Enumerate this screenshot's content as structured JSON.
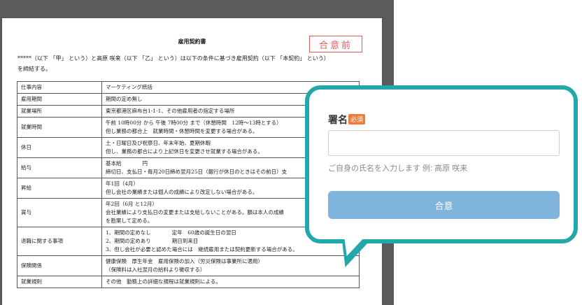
{
  "document": {
    "title": "雇用契約書",
    "stamp": "合意前",
    "intro_line1": "*****（以下 「甲」 という）と高原 咲来（以下 「乙」 という）は以下の条件に基づき雇用契約（以下 「本契約」 という）",
    "intro_line2": "を締結する。",
    "rows": [
      {
        "label": "仕事内容",
        "lines": [
          "マーケティング統括"
        ]
      },
      {
        "label": "雇用期間",
        "lines": [
          "期間の定め無し"
        ]
      },
      {
        "label": "就業場所",
        "lines": [
          "東京都港区麻布台1-1-1、その他雇用者の指定する場所"
        ]
      },
      {
        "label": "就業時間",
        "lines": [
          "午前 10時00分 から 午後 7時00分 まで（休憩時間　12時〜13時とする）",
          "但し業務の都合上　就業時間・休憩時間を変更する場合がある。"
        ]
      },
      {
        "label": "休日",
        "lines": [
          "土・日曜日及び祝祭日、年末年始、夏期休暇",
          "但し、業務の都合により上記休日を変更させ就業する場合がある。"
        ]
      },
      {
        "label": "給与",
        "lines": [
          "基本給　　　　円",
          "締切日、支払日・毎月20日締め翌月25日（銀行が休日のときはその前日）支"
        ]
      },
      {
        "label": "昇給",
        "lines": [
          "年1回（4月）",
          "但し会社の業績または個人の成績により改定しない場合がある。"
        ]
      },
      {
        "label": "賞与",
        "lines": [
          "年2回（6月 と12月）",
          "会社業績により支払日の変更または支給しないことがある。額は本人の成績",
          "を勘案して定める。"
        ]
      },
      {
        "label": "退職に関する事項",
        "lines": [
          "1、期間の定めなし　　　　定年　60歳の誕生日の翌日",
          "2、期間の定めあり　　　　期日到来日",
          "3、但し会社が必要と認めた場合には　継続雇用または契約更新する場合がある。"
        ]
      },
      {
        "label": "保険関係",
        "lines": [
          "健康保険　厚生年金　雇用保険の加入（労災保険は事業所に適用）",
          "（保険料は入社翌月の給料より徴収する）"
        ]
      },
      {
        "label": "就業規則",
        "lines": [
          "その他　勤務上の詳細な規程は就業規則による。"
        ]
      }
    ]
  },
  "signature": {
    "label": "署名",
    "required_badge": "必須",
    "value": "",
    "hint": "ご自身の氏名を入力します 例: 高原 咲来",
    "agree_button": "合意"
  },
  "colors": {
    "callout_border": "#22a8a8",
    "stamp": "#e45b5b",
    "required_badge": "#f07b3a",
    "button": "#7fb5dc"
  }
}
